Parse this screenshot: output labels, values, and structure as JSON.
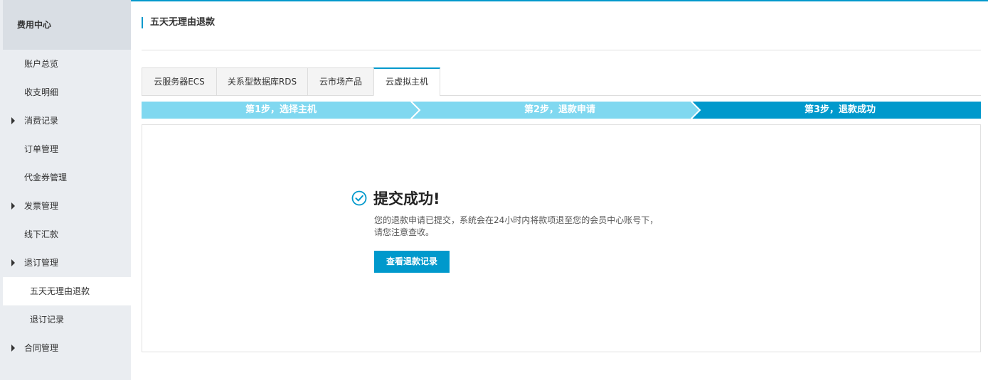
{
  "sidebar": {
    "header": "费用中心",
    "items": [
      {
        "label": "账户总览"
      },
      {
        "label": "收支明细"
      },
      {
        "label": "消费记录"
      },
      {
        "label": "订单管理"
      },
      {
        "label": "代金券管理"
      },
      {
        "label": "发票管理"
      },
      {
        "label": "线下汇款"
      },
      {
        "label": "退订管理"
      },
      {
        "label": "五天无理由退款"
      },
      {
        "label": "退订记录"
      },
      {
        "label": "合同管理"
      }
    ]
  },
  "page": {
    "title": "五天无理由退款"
  },
  "tabs": [
    {
      "label": "云服务器ECS"
    },
    {
      "label": "关系型数据库RDS"
    },
    {
      "label": "云市场产品"
    },
    {
      "label": "云虚拟主机"
    }
  ],
  "steps": [
    {
      "label": "第1步，选择主机"
    },
    {
      "label": "第2步，退款申请"
    },
    {
      "label": "第3步，退款成功"
    }
  ],
  "result": {
    "title": "提交成功!",
    "message_line1": "您的退款申请已提交，系统会在24小时内将款项退至您的会员中心账号下，",
    "message_line2": "请您注意查收。",
    "button_label": "查看退款记录"
  },
  "colors": {
    "accent": "#0099cc",
    "step_inactive": "#80d8f0",
    "step_active": "#0099cc",
    "sidebar_bg": "#eaedf1"
  }
}
